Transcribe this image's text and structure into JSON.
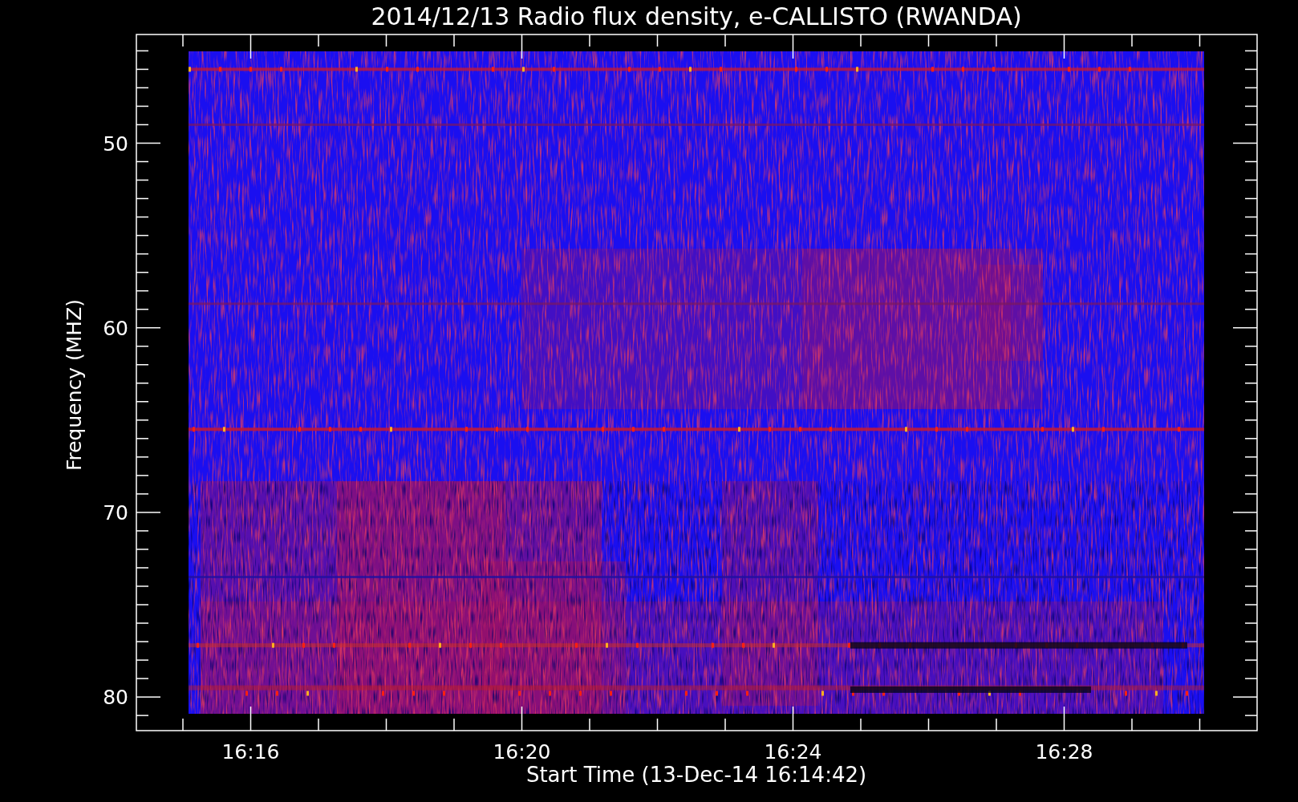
{
  "title": "2014/12/13  Radio flux density, e-CALLISTO (RWANDA)",
  "x_axis": {
    "label": "Start Time (13-Dec-14 16:14:42)",
    "ticks": [
      "16:16",
      "16:20",
      "16:24",
      "16:28"
    ]
  },
  "y_axis": {
    "label": "Frequency (MHZ)",
    "ticks": [
      "50",
      "60",
      "70",
      "80"
    ]
  }
}
